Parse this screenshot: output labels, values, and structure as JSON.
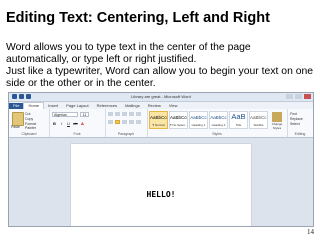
{
  "slide": {
    "title": "Editing Text: Centering, Left and Right",
    "paragraph1": "Word allows you to type text in the center of the page automatically, or type left or right justified.",
    "paragraph2": "Just like a typewriter, Word can allow you to begin your text on one side or the other or in the center.",
    "page_number": "14"
  },
  "word": {
    "window_title": "Library are great - Microsoft Word",
    "tabs": [
      "File",
      "Home",
      "Insert",
      "Page Layout",
      "References",
      "Mailings",
      "Review",
      "View"
    ],
    "active_tab": "Home",
    "clipboard": {
      "paste_label": "Paste",
      "cut": "Cut",
      "copy": "Copy",
      "format_painter": "Format Painter",
      "group_label": "Clipboard"
    },
    "font": {
      "name": "Algerian",
      "size": "11",
      "group_label": "Font"
    },
    "paragraph_group_label": "Paragraph",
    "styles": {
      "items": [
        {
          "sample": "AaBbCcDc",
          "name": "¶ Normal"
        },
        {
          "sample": "AaBbCcDc",
          "name": "¶ No Spaci..."
        },
        {
          "sample": "AaBbCc",
          "name": "Heading 1"
        },
        {
          "sample": "AaBbCc",
          "name": "Heading 2"
        },
        {
          "sample": "AaB",
          "name": "Title"
        },
        {
          "sample": "AaBbCc.",
          "name": "Subtitle"
        }
      ],
      "change_styles": "Change Styles",
      "group_label": "Styles"
    },
    "editing": {
      "find": "Find",
      "replace": "Replace",
      "select": "Select",
      "group_label": "Editing"
    },
    "document_text": "HELLO!"
  }
}
